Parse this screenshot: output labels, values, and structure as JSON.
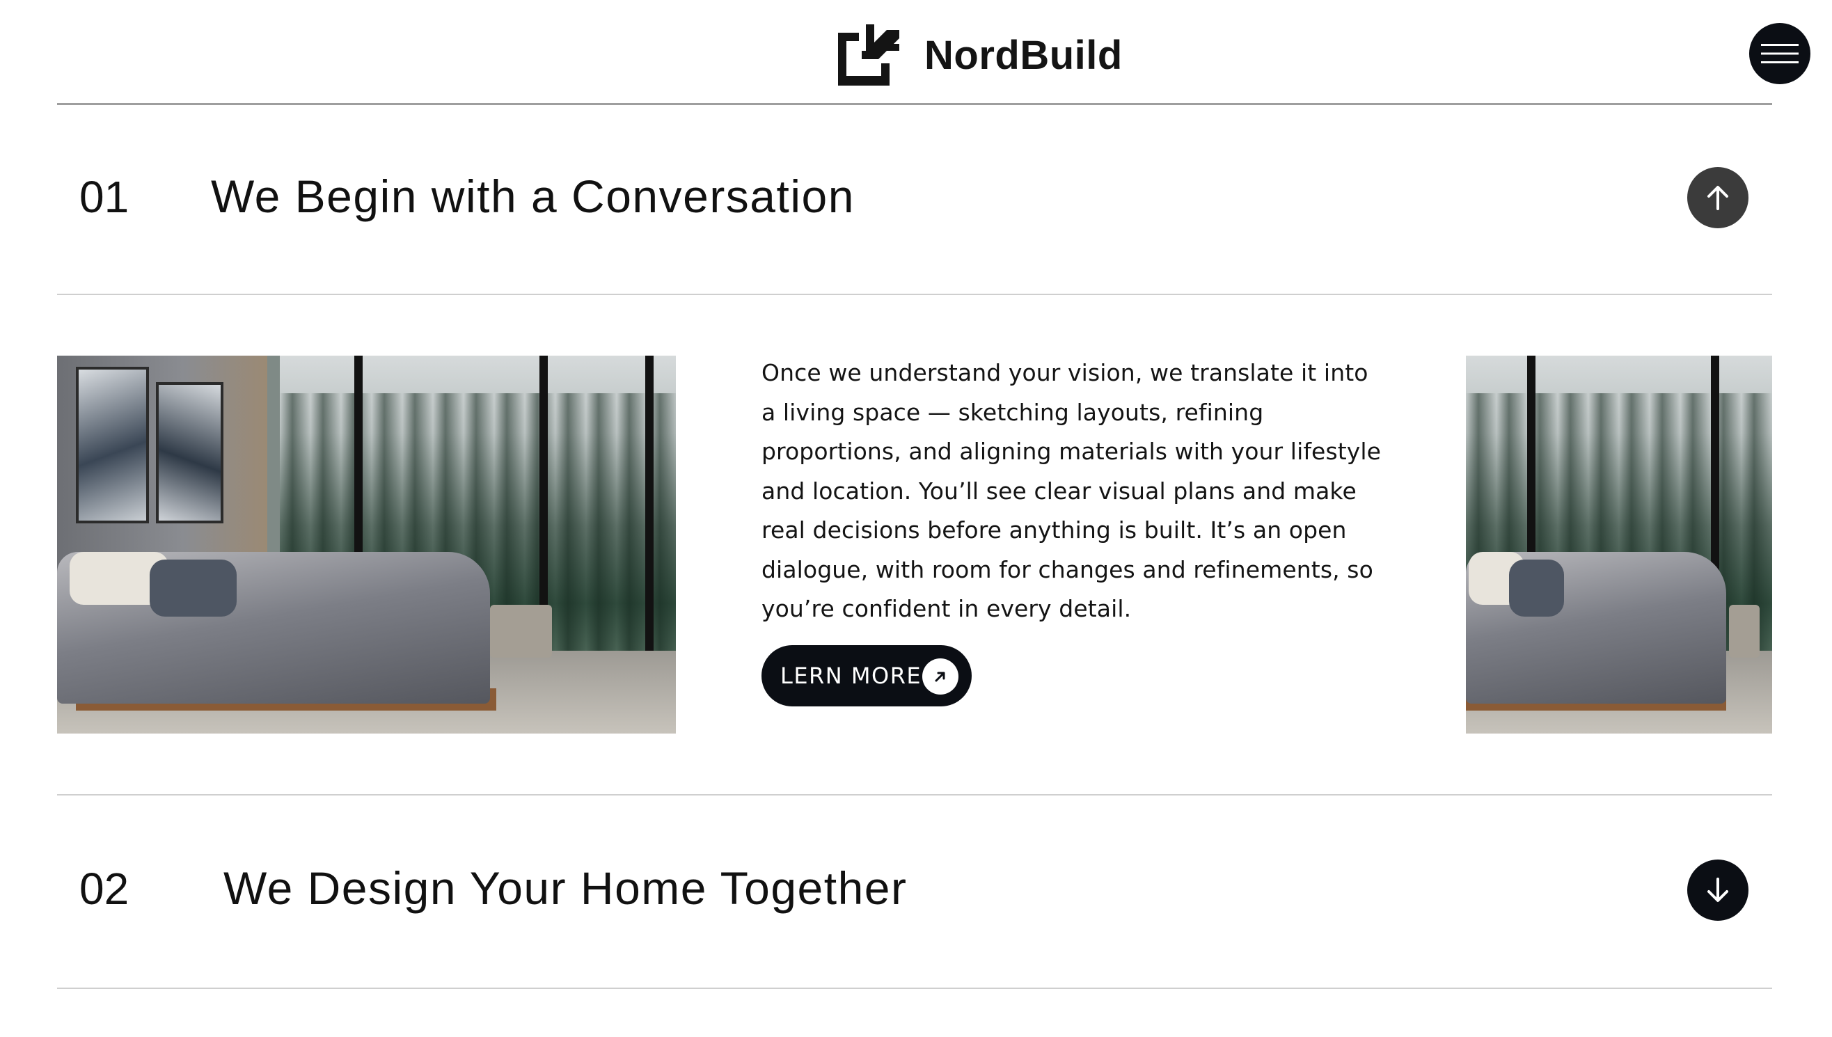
{
  "header": {
    "brand_name": "NordBuild",
    "logo_icon": "nordbuild-logo-icon",
    "menu_icon": "hamburger-menu-icon"
  },
  "steps": [
    {
      "number": "01",
      "title": "We Begin with a Conversation",
      "toggle_icon": "arrow-up-icon",
      "expanded": true,
      "body": "Once we understand your vision, we translate it into a living space — sketching layouts, refining proportions, and aligning materials with your lifestyle and location. You’ll see clear visual plans and make real decisions before anything is built. It’s an open dialogue, with room for changes and refinements, so you’re confident in every detail.",
      "cta_label": "LERN MORE",
      "cta_icon": "arrow-up-right-icon"
    },
    {
      "number": "02",
      "title": "We Design Your Home Together",
      "toggle_icon": "arrow-down-icon",
      "expanded": false
    }
  ],
  "colors": {
    "dark": "#0b0e14",
    "toggle_up": "#3b3b3b",
    "rule": "#cfcfcf"
  }
}
